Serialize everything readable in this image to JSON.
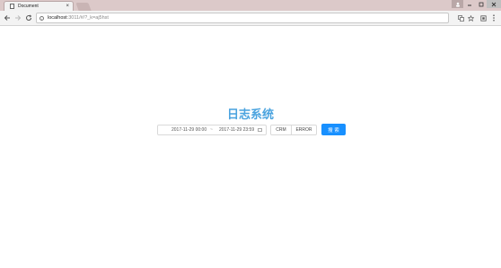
{
  "browser": {
    "tab_title": "Document",
    "tab_close": "×",
    "url_host": "localhost",
    "url_path": ":3011/#/?_k=aj5hst",
    "icons": [
      "document-icon",
      "close-icon",
      "back-icon",
      "forward-icon",
      "reload-icon",
      "info-icon",
      "translate-icon",
      "star-icon",
      "extension-icon",
      "menu-icon",
      "profile-icon",
      "minimize-icon",
      "maximize-icon",
      "window-close-icon"
    ]
  },
  "page": {
    "title": "日志系统",
    "date_range": {
      "start": "2017-11-29 00:00",
      "separator": "~",
      "end": "2017-11-29 23:59"
    },
    "filters": [
      "CRM",
      "ERROR"
    ],
    "search_label": "搜 索",
    "accent_color": "#1890ff",
    "title_color": "#4aa3df"
  }
}
